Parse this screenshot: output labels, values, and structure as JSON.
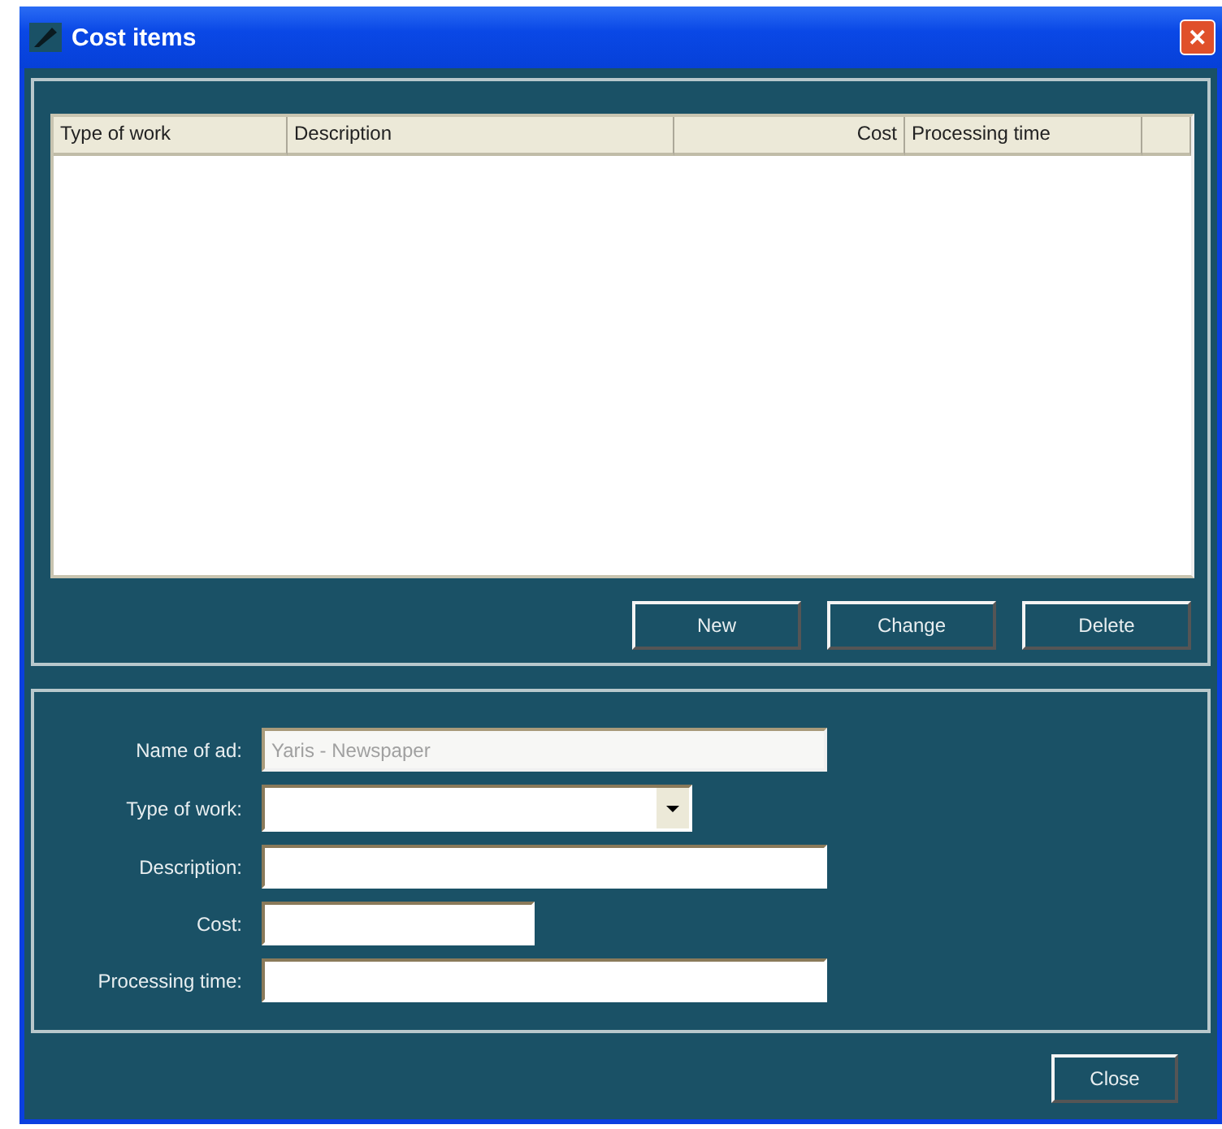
{
  "window": {
    "title": "Cost items",
    "close": "✕"
  },
  "table": {
    "columns": [
      "Type of work",
      "Description",
      "Cost",
      "Processing time"
    ]
  },
  "list_buttons": [
    "New",
    "Change",
    "Delete"
  ],
  "form": [
    {
      "label": "Name of ad:",
      "kind": "text",
      "value": "Yaris - Newspaper",
      "disabled": true
    },
    {
      "label": "Type of work:",
      "kind": "combo"
    },
    {
      "label": "Description:",
      "kind": "text",
      "disabled": false
    },
    {
      "label": "Cost:",
      "kind": "text",
      "disabled": false
    },
    {
      "label": "Processing time:",
      "kind": "text",
      "disabled": false
    }
  ],
  "footer_buttons": [
    "Close"
  ]
}
